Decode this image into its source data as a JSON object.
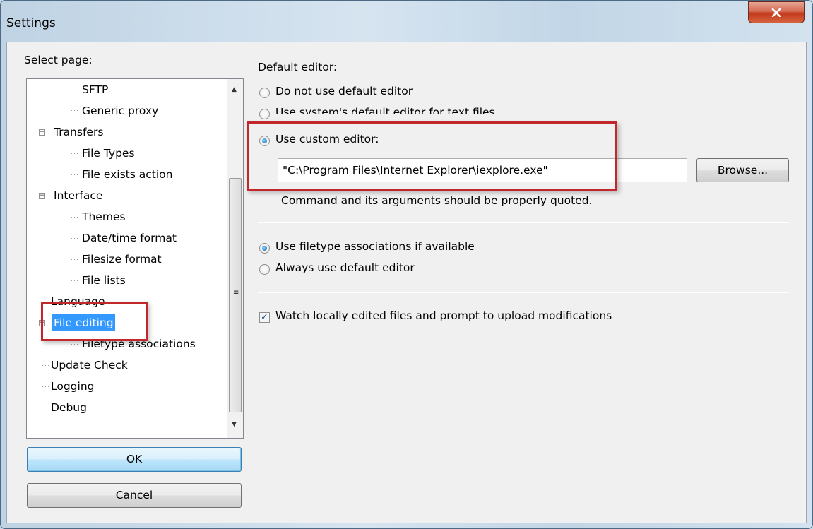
{
  "window": {
    "title": "Settings",
    "close_icon": "close-icon"
  },
  "left": {
    "select_page_label": "Select page:",
    "tree_items": [
      {
        "label": "SFTP"
      },
      {
        "label": "Generic proxy"
      },
      {
        "label": "Transfers"
      },
      {
        "label": "File Types"
      },
      {
        "label": "File exists action"
      },
      {
        "label": "Interface"
      },
      {
        "label": "Themes"
      },
      {
        "label": "Date/time format"
      },
      {
        "label": "Filesize format"
      },
      {
        "label": "File lists"
      },
      {
        "label": "Language"
      },
      {
        "label": "File editing"
      },
      {
        "label": "Filetype associations"
      },
      {
        "label": "Update Check"
      },
      {
        "label": "Logging"
      },
      {
        "label": "Debug"
      }
    ],
    "selected_item": "File editing",
    "ok_label": "OK",
    "cancel_label": "Cancel"
  },
  "right": {
    "default_editor_label": "Default editor:",
    "radio_none": "Do not use default editor",
    "radio_system": "Use system's default editor for text files",
    "radio_custom": "Use custom editor:",
    "custom_editor_value": "\"C:\\Program Files\\Internet Explorer\\iexplore.exe\"",
    "browse_label": "Browse...",
    "hint": "Command and its arguments should be properly quoted.",
    "radio_assoc": "Use filetype associations if available",
    "radio_always": "Always use default editor",
    "checkbox_watch": "Watch locally edited files and prompt to upload modifications"
  },
  "colors": {
    "highlight_box": "#c0282b",
    "selection": "#3399ff"
  }
}
